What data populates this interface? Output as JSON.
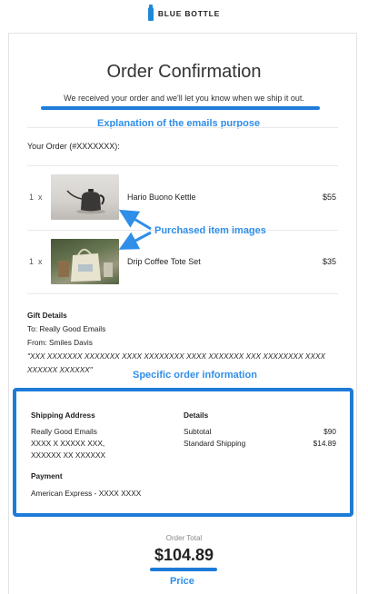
{
  "header": {
    "brand": "BLUE BOTTLE",
    "brand_color": "#1e88d8"
  },
  "confirmation": {
    "title": "Order Confirmation",
    "subtitle": "We received your order and we'll let you know when we ship it out."
  },
  "order": {
    "heading": "Your Order (#XXXXXXX):",
    "items": [
      {
        "qty": "1",
        "x": "x",
        "name": "Hario Buono Kettle",
        "price": "$55",
        "image": "kettle-photo"
      },
      {
        "qty": "1",
        "x": "x",
        "name": "Drip Coffee Tote Set",
        "price": "$35",
        "image": "tote-bag-photo"
      }
    ]
  },
  "gift": {
    "heading": "Gift Details",
    "to": "To: Really Good Emails",
    "from": "From: Smiles Davis",
    "message": "\"XXX XXXXXXX XXXXXXX XXXX XXXXXXXX XXXX XXXXXXX XXX XXXXXXXX XXXX XXXXXX XXXXXX\""
  },
  "shipping": {
    "address_heading": "Shipping Address",
    "address_lines": [
      "Really Good Emails",
      "XXXX X XXXXX XXX,",
      "XXXXXX XX XXXXXX"
    ],
    "details_heading": "Details",
    "subtotal_label": "Subtotal",
    "subtotal_value": "$90",
    "shipping_label": "Standard Shipping",
    "shipping_value": "$14.89",
    "payment_heading": "Payment",
    "payment_value": "American Express - XXXX XXXX"
  },
  "total": {
    "label": "Order Total",
    "value": "$104.89"
  },
  "annotations": {
    "emails_purpose": "Explanation of the emails purpose",
    "item_images": "Purchased item images",
    "order_info": "Specific order information",
    "price": "Price",
    "color": "#1e7bd8"
  }
}
